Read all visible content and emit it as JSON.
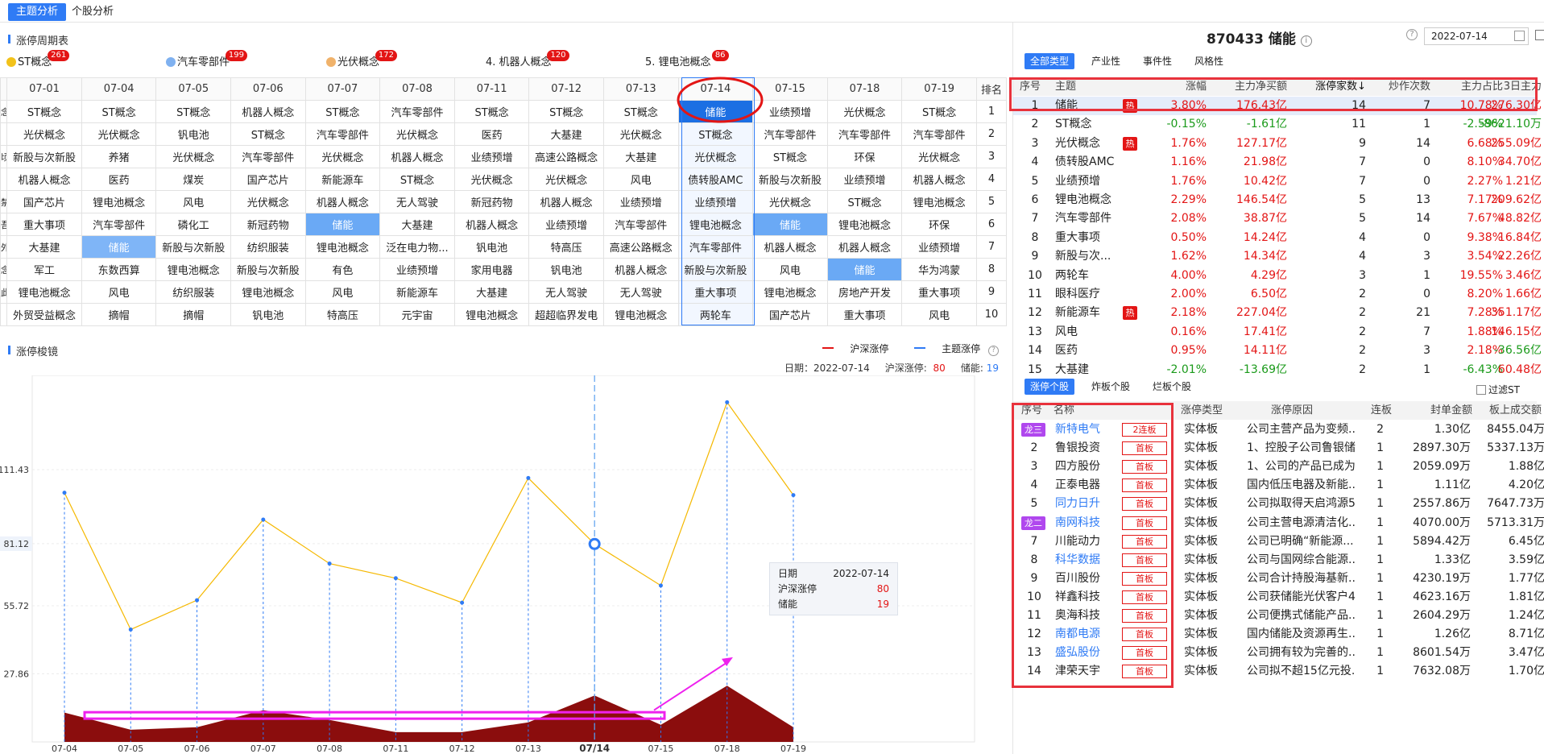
{
  "top_tabs": [
    "主题分析",
    "个股分析"
  ],
  "cycle_title": "涨停周期表",
  "theme_tabs": [
    {
      "label": "ST概念",
      "count": "261",
      "icon": "gold-coin-icon"
    },
    {
      "label": "汽车零部件",
      "count": "199",
      "icon": "blue-coin-icon"
    },
    {
      "label": "光伏概念",
      "count": "172",
      "icon": "orange-coin-icon"
    },
    {
      "label": "4. 机器人概念",
      "count": "120"
    },
    {
      "label": "5. 锂电池概念",
      "count": "86"
    }
  ],
  "cycle_table": {
    "dates": [
      "07-01",
      "07-04",
      "07-05",
      "07-06",
      "07-07",
      "07-08",
      "07-11",
      "07-12",
      "07-13",
      "07-14",
      "07-15",
      "07-18",
      "07-19"
    ],
    "rank_label": "排名",
    "left_stub": [
      "念",
      "",
      "顷",
      "",
      "禁",
      "吾股",
      "外",
      "念",
      "此念",
      ""
    ],
    "rows": [
      [
        "ST概念",
        "ST概念",
        "ST概念",
        "机器人概念",
        "ST概念",
        "汽车零部件",
        "ST概念",
        "ST概念",
        "ST概念",
        "储能",
        "业绩预增",
        "光伏概念",
        "ST概念"
      ],
      [
        "光伏概念",
        "光伏概念",
        "钒电池",
        "ST概念",
        "汽车零部件",
        "光伏概念",
        "医药",
        "大基建",
        "光伏概念",
        "ST概念",
        "汽车零部件",
        "汽车零部件",
        "汽车零部件"
      ],
      [
        "新股与次新股",
        "养猪",
        "光伏概念",
        "汽车零部件",
        "光伏概念",
        "机器人概念",
        "业绩预增",
        "高速公路概念",
        "大基建",
        "光伏概念",
        "ST概念",
        "环保",
        "光伏概念"
      ],
      [
        "机器人概念",
        "医药",
        "煤炭",
        "国产芯片",
        "新能源车",
        "ST概念",
        "光伏概念",
        "光伏概念",
        "风电",
        "债转股AMC",
        "新股与次新股",
        "业绩预增",
        "机器人概念"
      ],
      [
        "国产芯片",
        "锂电池概念",
        "风电",
        "光伏概念",
        "机器人概念",
        "无人驾驶",
        "新冠药物",
        "机器人概念",
        "业绩预增",
        "业绩预增",
        "光伏概念",
        "ST概念",
        "锂电池概念"
      ],
      [
        "重大事项",
        "汽车零部件",
        "磷化工",
        "新冠药物",
        "储能",
        "大基建",
        "机器人概念",
        "业绩预增",
        "汽车零部件",
        "锂电池概念",
        "储能",
        "锂电池概念",
        "环保"
      ],
      [
        "大基建",
        "储能",
        "新股与次新股",
        "纺织服装",
        "锂电池概念",
        "泛在电力物...",
        "钒电池",
        "特高压",
        "高速公路概念",
        "汽车零部件",
        "机器人概念",
        "机器人概念",
        "业绩预增"
      ],
      [
        "军工",
        "东数西算",
        "锂电池概念",
        "新股与次新股",
        "有色",
        "业绩预增",
        "家用电器",
        "钒电池",
        "机器人概念",
        "新股与次新股",
        "风电",
        "储能",
        "华为鸿蒙"
      ],
      [
        "锂电池概念",
        "风电",
        "纺织服装",
        "锂电池概念",
        "风电",
        "新能源车",
        "大基建",
        "无人驾驶",
        "无人驾驶",
        "重大事项",
        "锂电池概念",
        "房地产开发",
        "重大事项"
      ],
      [
        "外贸受益概念",
        "摘帽",
        "摘帽",
        "钒电池",
        "特高压",
        "元宇宙",
        "锂电池概念",
        "超超临界发电",
        "锂电池概念",
        "两轮车",
        "国产芯片",
        "重大事项",
        "风电"
      ]
    ]
  },
  "chart": {
    "title": "涨停梭镜",
    "legend": [
      "沪深涨停",
      "主题涨停"
    ],
    "info": {
      "date_label": "日期：",
      "date": "2022-07-14",
      "hs_label": "沪深涨停:",
      "hs": "80",
      "theme_label": "储能:",
      "theme": "19"
    },
    "tooltip": {
      "date_label": "日期",
      "date": "2022-07-14",
      "hs_label": "沪深涨停",
      "hs": "80",
      "theme_label": "储能",
      "theme": "19"
    },
    "cursor_value": "81.12"
  },
  "chart_data": {
    "type": "line",
    "x": [
      "07-04",
      "07-05",
      "07-06",
      "07-07",
      "07-08",
      "07-11",
      "07-12",
      "07-13",
      "07-14",
      "07-15",
      "07-18",
      "07-19"
    ],
    "ytick_labels": [
      "27.86",
      "55.72",
      "81.12",
      "111.43"
    ],
    "series": [
      {
        "name": "沪深涨停",
        "values": [
          102,
          46,
          58,
          91,
          73,
          67,
          57,
          108,
          81,
          64,
          139,
          101
        ],
        "color": "#f5b800"
      },
      {
        "name": "主题涨停",
        "values": [
          12,
          5,
          6,
          13,
          9,
          4,
          4,
          8,
          19,
          7,
          23,
          6
        ],
        "color": "#8b0d0d"
      }
    ]
  },
  "right": {
    "stock_title": "870433 储能",
    "date": "2022-07-14",
    "theme_tabs": [
      "全部类型",
      "产业性",
      "事件性",
      "风格性"
    ],
    "theme_headers": [
      "序号",
      "主题",
      "涨幅",
      "主力净买额",
      "涨停家数↓",
      "炒作次数",
      "主力占比",
      "3日主力"
    ],
    "theme_rows": [
      [
        "1",
        "储能",
        "3.80%",
        "176.43亿",
        "14",
        "7",
        "10.78%",
        "276.30亿",
        "hot"
      ],
      [
        "2",
        "ST概念",
        "-0.15%",
        "-1.61亿",
        "11",
        "1",
        "-2.59%",
        "-8621.10万",
        ""
      ],
      [
        "3",
        "光伏概念",
        "1.76%",
        "127.17亿",
        "9",
        "14",
        "6.68%",
        "255.09亿",
        "hot"
      ],
      [
        "4",
        "债转股AMC",
        "1.16%",
        "21.98亿",
        "7",
        "0",
        "8.10%",
        "34.70亿",
        ""
      ],
      [
        "5",
        "业绩预增",
        "1.76%",
        "10.42亿",
        "7",
        "0",
        "2.27%",
        "1.21亿",
        ""
      ],
      [
        "6",
        "锂电池概念",
        "2.29%",
        "146.54亿",
        "5",
        "13",
        "7.17%",
        "209.62亿",
        ""
      ],
      [
        "7",
        "汽车零部件",
        "2.08%",
        "38.87亿",
        "5",
        "14",
        "7.67%",
        "48.82亿",
        ""
      ],
      [
        "8",
        "重大事项",
        "0.50%",
        "14.24亿",
        "4",
        "0",
        "9.38%",
        "16.84亿",
        ""
      ],
      [
        "9",
        "新股与次...",
        "1.62%",
        "14.34亿",
        "4",
        "3",
        "3.54%",
        "22.26亿",
        ""
      ],
      [
        "10",
        "两轮车",
        "4.00%",
        "4.29亿",
        "3",
        "1",
        "19.55%",
        "3.46亿",
        ""
      ],
      [
        "11",
        "眼科医疗",
        "2.00%",
        "6.50亿",
        "2",
        "0",
        "8.20%",
        "1.66亿",
        ""
      ],
      [
        "12",
        "新能源车",
        "2.18%",
        "227.04亿",
        "2",
        "21",
        "7.28%",
        "351.17亿",
        "hot"
      ],
      [
        "13",
        "风电",
        "0.16%",
        "17.41亿",
        "2",
        "7",
        "1.88%",
        "146.15亿",
        ""
      ],
      [
        "14",
        "医药",
        "0.95%",
        "14.11亿",
        "2",
        "3",
        "2.18%",
        "-36.56亿",
        ""
      ],
      [
        "15",
        "大基建",
        "-2.01%",
        "-13.69亿",
        "2",
        "1",
        "-6.43%",
        "60.48亿",
        ""
      ]
    ],
    "hot_label": "热",
    "stock_tabs": [
      "涨停个股",
      "炸板个股",
      "烂板个股"
    ],
    "filter_label": "过滤ST",
    "stock_headers": [
      "序号",
      "名称",
      "涨停类型",
      "涨停原因",
      "连板",
      "封单金额",
      "板上成交额"
    ],
    "stock_rows": [
      [
        "龙三",
        "新特电气",
        "2连板",
        "实体板",
        "公司主营产品为变频...",
        "2",
        "1.30亿",
        "8455.04万"
      ],
      [
        "2",
        "鲁银投资",
        "首板",
        "实体板",
        "1、控股子公司鲁银储...",
        "1",
        "2897.30万",
        "5337.13万"
      ],
      [
        "3",
        "四方股份",
        "首板",
        "实体板",
        "1、公司的产品已成为...",
        "1",
        "2059.09万",
        "1.88亿"
      ],
      [
        "4",
        "正泰电器",
        "首板",
        "实体板",
        "国内低压电器及新能...",
        "1",
        "1.11亿",
        "4.20亿"
      ],
      [
        "5",
        "同力日升",
        "首板",
        "实体板",
        "公司拟取得天启鸿源5...",
        "1",
        "2557.86万",
        "7647.73万"
      ],
      [
        "龙二",
        "南网科技",
        "首板",
        "实体板",
        "公司主营电源清洁化...",
        "1",
        "4070.00万",
        "5713.31万"
      ],
      [
        "7",
        "川能动力",
        "首板",
        "实体板",
        "公司已明确“新能源...",
        "1",
        "5894.42万",
        "6.45亿"
      ],
      [
        "8",
        "科华数据",
        "首板",
        "实体板",
        "公司与国网综合能源...",
        "1",
        "1.33亿",
        "3.59亿"
      ],
      [
        "9",
        "百川股份",
        "首板",
        "实体板",
        "公司合计持股海基新...",
        "1",
        "4230.19万",
        "1.77亿"
      ],
      [
        "10",
        "祥鑫科技",
        "首板",
        "实体板",
        "公司获储能光伏客户4...",
        "1",
        "4623.16万",
        "1.81亿"
      ],
      [
        "11",
        "奥海科技",
        "首板",
        "实体板",
        "公司便携式储能产品...",
        "1",
        "2604.29万",
        "1.24亿"
      ],
      [
        "12",
        "南都电源",
        "首板",
        "实体板",
        "国内储能及资源再生...",
        "1",
        "1.26亿",
        "8.71亿"
      ],
      [
        "13",
        "盛弘股份",
        "首板",
        "实体板",
        "公司拥有较为完善的...",
        "1",
        "8601.54万",
        "3.47亿"
      ],
      [
        "14",
        "津荣天宇",
        "首板",
        "实体板",
        "公司拟不超15亿元投...",
        "1",
        "7632.08万",
        "1.70亿"
      ]
    ],
    "blue_names": [
      "新特电气",
      "同力日升",
      "南网科技",
      "科华数据",
      "南都电源",
      "盛弘股份"
    ]
  }
}
